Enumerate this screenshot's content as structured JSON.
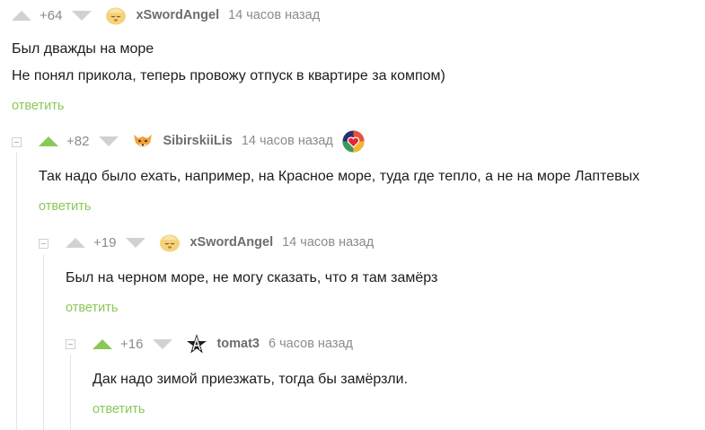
{
  "comments": [
    {
      "rating": "+64",
      "author": "xSwordAngel",
      "time": "14 часов назад",
      "lines": [
        "Был дважды на море",
        "Не понял прикола, теперь провожу отпуск в квартире за компом)"
      ],
      "reply": "ответить",
      "avatar": "sleeping-face-avatar",
      "upvoted": false
    },
    {
      "rating": "+82",
      "author": "SibirskiiLis",
      "time": "14 часов назад",
      "lines": [
        "Так надо было ехать, например, на Красное море, туда где тепло, а не на море Лаптевых"
      ],
      "reply": "ответить",
      "avatar": "fox-avatar",
      "badge": "heart-badge",
      "upvoted": true
    },
    {
      "rating": "+19",
      "author": "xSwordAngel",
      "time": "14 часов назад",
      "lines": [
        "Был на черном море, не могу сказать, что я там замёрз"
      ],
      "reply": "ответить",
      "avatar": "sleeping-face-avatar",
      "upvoted": false
    },
    {
      "rating": "+16",
      "author": "tomat3",
      "time": "6 часов назад",
      "lines": [
        "Дак надо зимой приезжать, тогда бы замёрзли."
      ],
      "reply": "ответить",
      "avatar": "anarchy-star-avatar",
      "upvoted": true
    }
  ],
  "colors": {
    "accent": "#8ac858",
    "vote_inactive": "#cfd2d4",
    "meta": "#8b8b8b",
    "author": "#6d6d6d",
    "text": "#1d1d1d"
  }
}
